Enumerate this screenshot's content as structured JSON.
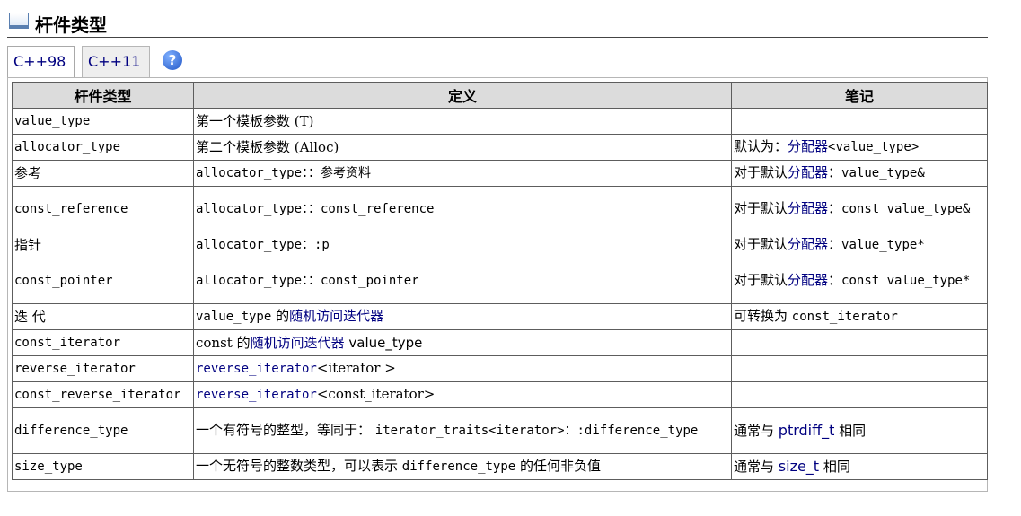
{
  "section": {
    "title": "杆件类型"
  },
  "tabs": [
    {
      "label": "C++98"
    },
    {
      "label": "C++11"
    }
  ],
  "help": {
    "glyph": "?"
  },
  "table": {
    "headers": [
      "杆件类型",
      "定义",
      "笔记"
    ],
    "rows": [
      {
        "type": "value_type",
        "def": {
          "a": "第一个模板参数 ",
          "b": "(T)"
        },
        "note": {}
      },
      {
        "type": "allocator_type",
        "def": {
          "a": "第二个模板参数 ",
          "b": "(Alloc)"
        },
        "note": {
          "a": "默认为：",
          "b": "分配器",
          "c": "<value_type>"
        }
      },
      {
        "type": "参考",
        "def": {
          "a": "allocator_type：：参考资料"
        },
        "note": {
          "a": "对于默认",
          "b": "分配器",
          "c": "：",
          "d": "value_type&"
        }
      },
      {
        "type": "const_reference",
        "def": {
          "a": "allocator_type：：const_reference"
        },
        "note": {
          "a": "对于默认",
          "b": "分配器",
          "c": "：",
          "d": "const value_type&"
        }
      },
      {
        "type": "指针",
        "def": {
          "a": "allocator_type：:p"
        },
        "note": {
          "a": "对于默认",
          "b": "分配器",
          "c": "：",
          "d": "value_type*"
        }
      },
      {
        "type": "const_pointer",
        "def": {
          "a": "allocator_type：：const_pointer"
        },
        "note": {
          "a": "对于默认",
          "b": "分配器",
          "c": "：",
          "d": "const value_type*"
        }
      },
      {
        "type": "迭 代",
        "def": {
          "a": "value_type",
          "b": " 的",
          "c": "随机访问迭代器"
        },
        "note": {
          "a": "可转换为 ",
          "b": "const_iterator"
        }
      },
      {
        "type": "const_iterator",
        "def": {
          "a": "const 的",
          "b": "随机访问迭代器",
          "c": " value_type"
        },
        "note": {}
      },
      {
        "type": "reverse_iterator",
        "def": {
          "a": "reverse_iterator",
          "b": "<iterator >"
        },
        "note": {}
      },
      {
        "type": "const_reverse_iterator",
        "def": {
          "a": "reverse_iterator",
          "b": "<const_iterator>"
        },
        "note": {}
      },
      {
        "type": "difference_type",
        "def": {
          "a": "一个有符号的整型，等同于： ",
          "b": "iterator_traits<iterator>：:difference_type"
        },
        "note": {
          "a": "通常与 ",
          "b": "ptrdiff_t",
          "c": " 相同"
        }
      },
      {
        "type": "size_type",
        "def": {
          "a": "一个无符号的整数类型，可以表示 ",
          "b": "difference_type",
          "c": " 的任何非负值"
        },
        "note": {
          "a": "通常与 ",
          "b": "size_t",
          "c": " 相同"
        }
      }
    ]
  }
}
